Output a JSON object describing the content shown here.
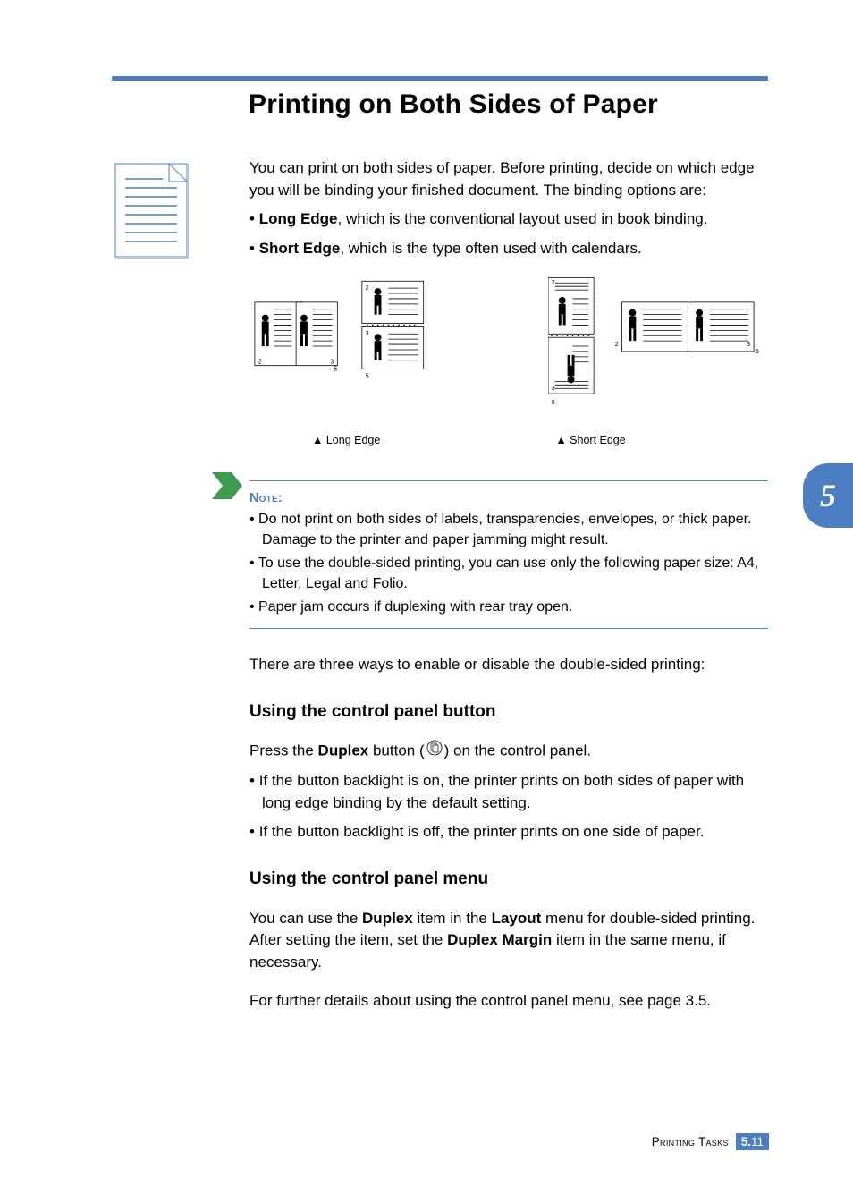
{
  "title": "Printing on Both Sides of Paper",
  "intro": {
    "p1": "You can print on both sides of paper. Before printing, decide on which edge you will be binding your finished document. The binding options are:",
    "long_edge_label": "Long Edge",
    "long_edge_text": ", which is the conventional layout used in book binding.",
    "short_edge_label": "Short Edge",
    "short_edge_text": ", which is the type often used with calendars."
  },
  "captions": {
    "long": "▲ Long Edge",
    "short": "▲ Short Edge"
  },
  "tab": "5",
  "note": {
    "head": "Note:",
    "items": [
      "Do not print on both sides of labels, transparencies, envelopes, or thick paper. Damage to the printer and paper jamming might result.",
      "To use the double-sided printing, you can use only the following paper size: A4, Letter, Legal and Folio.",
      "Paper jam occurs if duplexing with rear tray open."
    ]
  },
  "three_ways": "There are three ways to enable or disable the double-sided printing:",
  "cpb": {
    "head": "Using the control panel button",
    "press_pre": "Press the ",
    "duplex": "Duplex",
    "press_mid": " button (",
    "press_post": ") on the control panel.",
    "items": [
      "If the button backlight is on, the printer prints on both sides of paper with long edge binding by the default setting.",
      "If the button backlight is off, the printer prints on one side of paper."
    ]
  },
  "cpm": {
    "head": "Using the control panel menu",
    "p_pre": "You can use the ",
    "duplex": "Duplex",
    "p_mid1": " item in the ",
    "layout": "Layout",
    "p_mid2": " menu for double-sided printing. After setting the item, set the ",
    "dmargin": "Duplex Margin",
    "p_post": " item in the same menu, if necessary.",
    "p2": "For further details about using the control panel menu, see page 3.5."
  },
  "footer": {
    "section": "Printing Tasks",
    "chapter": "5.",
    "page": "11"
  }
}
